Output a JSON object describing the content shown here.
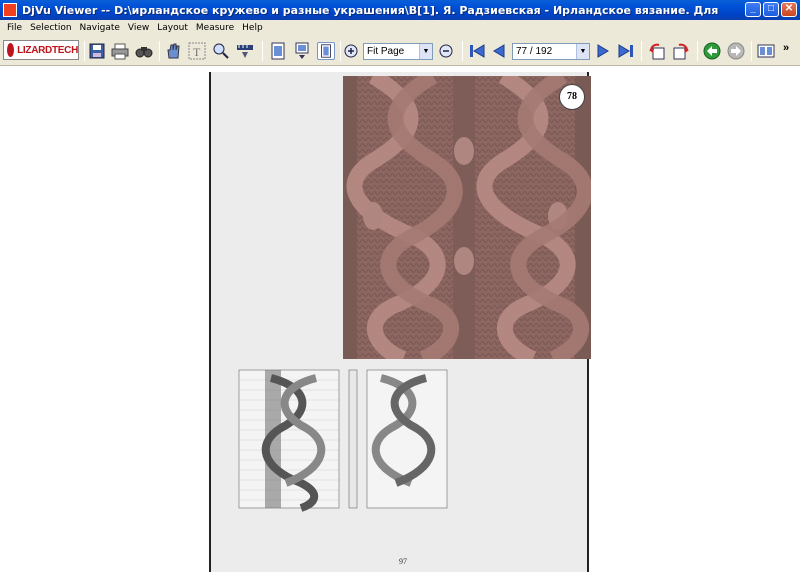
{
  "window": {
    "title": "DjVu Viewer -- D:\\ирландское кружево и разные украшения\\B[1]. Я. Радзиевская - Ирландское вязание. Для тех, кто любит вязать.djvu",
    "minimize": "_",
    "maximize": "□",
    "close": "✕"
  },
  "menu": {
    "items": [
      "File",
      "Selection",
      "Navigate",
      "View",
      "Layout",
      "Measure",
      "Help"
    ]
  },
  "toolbar": {
    "logo_text": "LIZARDTECH",
    "zoom_value": "Fit Page",
    "page_value": "77 / 192",
    "icons": [
      "save-icon",
      "print-icon",
      "find-icon",
      "hand-icon",
      "text-select-icon",
      "zoom-icon",
      "measure-icon",
      "single-page-icon",
      "continuous-icon",
      "facing-icon",
      "zoom-in-icon",
      "zoom-out-icon",
      "first-page-icon",
      "prev-page-icon",
      "next-page-icon",
      "last-page-icon",
      "rotate-left-icon",
      "rotate-right-icon",
      "back-icon",
      "forward-icon",
      "thumbnails-icon"
    ],
    "overflow": "»",
    "dropdown_arrow": "▼"
  },
  "document": {
    "pattern_number": "78",
    "page_number": "97"
  }
}
